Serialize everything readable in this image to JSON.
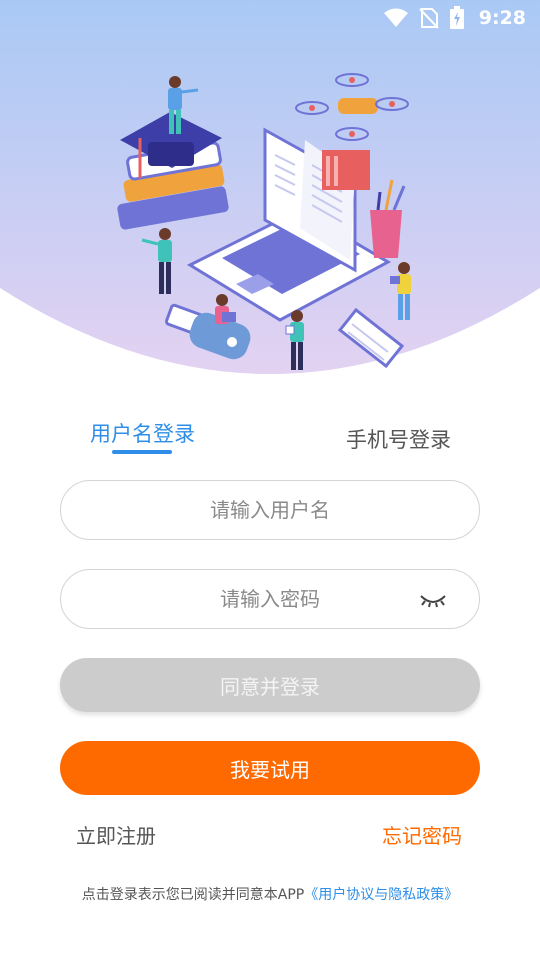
{
  "status_bar": {
    "time": "9:28",
    "icons": [
      "wifi-icon",
      "no-sim-icon",
      "battery-charging-icon"
    ]
  },
  "colors": {
    "accent_blue": "#2f8fe8",
    "accent_orange": "#ff6a00",
    "disabled_gray": "#cccccc",
    "hero_gradient_top": "#a9c9f5",
    "hero_gradient_bottom": "#e3d2f2"
  },
  "tabs": {
    "username_login": "用户名登录",
    "phone_login": "手机号登录",
    "active": "username_login"
  },
  "form": {
    "username_placeholder": "请输入用户名",
    "username_value": "",
    "password_placeholder": "请输入密码",
    "password_value": ""
  },
  "buttons": {
    "login": "同意并登录",
    "trial": "我要试用"
  },
  "links": {
    "register": "立即注册",
    "forgot_password": "忘记密码"
  },
  "agreement": {
    "prefix": "点击登录表示您已阅读并同意本APP",
    "link": "《用户协议与隐私政策》"
  }
}
